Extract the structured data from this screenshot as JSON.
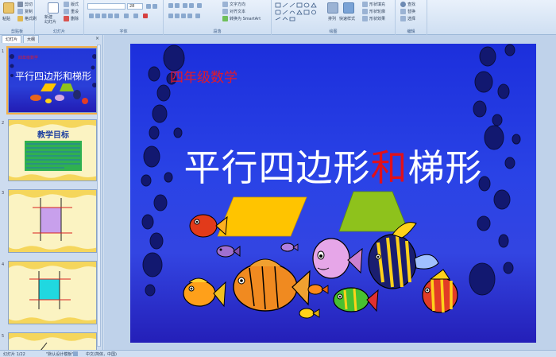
{
  "ribbon": {
    "clipboard": {
      "paste": "粘贴",
      "cut": "剪切",
      "copy": "复制",
      "format_painter": "格式刷",
      "label": "剪贴板"
    },
    "slides": {
      "new_slide": "新建\n幻灯片",
      "layout": "版式",
      "reset": "重设",
      "delete": "删除",
      "label": "幻灯片"
    },
    "font": {
      "size_value": "28",
      "label": "字体"
    },
    "paragraph": {
      "text_direction": "文字方向",
      "align_text": "对齐文本",
      "smartart": "转换为 SmartArt",
      "label": "段落"
    },
    "drawing": {
      "arrange": "排列",
      "quick_styles": "快速样式",
      "shape_fill": "形状填充",
      "shape_outline": "形状轮廓",
      "shape_effects": "形状效果",
      "label": "绘图"
    },
    "editing": {
      "find": "查找",
      "replace": "替换",
      "select": "选择",
      "label": "编辑"
    }
  },
  "pane": {
    "tab_slides": "幻灯片",
    "tab_outline": "大纲",
    "close": "×",
    "thumbs": [
      {
        "num": "1",
        "caption": "四年级数学",
        "title": "平行四边形和梯形"
      },
      {
        "num": "2",
        "title": "教学目标"
      },
      {
        "num": "3"
      },
      {
        "num": "4"
      },
      {
        "num": "5"
      }
    ]
  },
  "slide": {
    "subtitle": "四年级数学",
    "title_part1": "平行四边形",
    "title_highlight": "和",
    "title_part2": "梯形"
  },
  "status": {
    "slide_count": "幻灯片 1/22",
    "theme": "\"默认设计模板\"",
    "language": "中文(简体，中国)"
  },
  "colors": {
    "slide_bg": "#2a43e6",
    "title": "#ffffff",
    "highlight": "#e0101a",
    "parallelogram": "#ffc400",
    "trapezoid": "#8ec21c"
  }
}
